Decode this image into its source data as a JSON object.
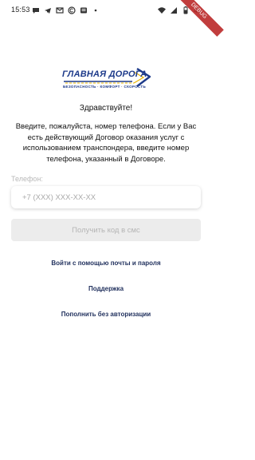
{
  "status_bar": {
    "time": "15:53",
    "battery": "45",
    "icons_left": [
      "chat-icon",
      "telegram-icon",
      "gmail-icon",
      "copyright-icon",
      "news-icon",
      "dot-icon"
    ],
    "icons_right": [
      "wifi-icon",
      "signal-icon",
      "battery-icon"
    ]
  },
  "debug_banner": "DEBUG",
  "logo": {
    "title": "ГЛАВНАЯ ДОРОГА",
    "subtitle": "БЕЗОПАСНОСТЬ · КОМФОРТ · СКОРОСТЬ"
  },
  "greeting": "Здравствуйте!",
  "intro": "Введите, пожалуйста, номер телефона. Если у Вас есть действующий Договор оказания услуг с использованием транспондера, введите номер телефона, указанный в Договоре.",
  "phone": {
    "label": "Телефон:",
    "placeholder": "+7 (XXX) XXX-XX-XX",
    "value": ""
  },
  "sms_button": "Получить код в смс",
  "links": {
    "email_login": "Войти с помощью почты и пароля",
    "support": "Поддержка",
    "pay_without_auth": "Пополнить без авторизации"
  }
}
